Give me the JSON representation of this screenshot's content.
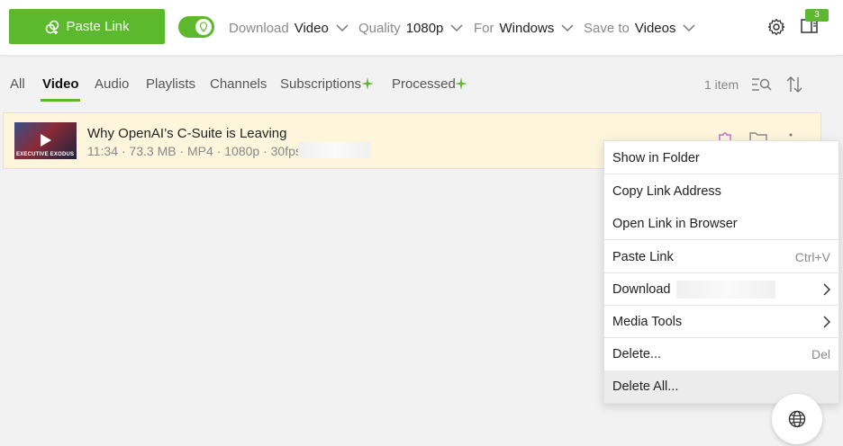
{
  "toolbar": {
    "paste_label": "Paste Link",
    "download": {
      "label": "Download",
      "value": "Video"
    },
    "quality": {
      "label": "Quality",
      "value": "1080p"
    },
    "for": {
      "label": "For",
      "value": "Windows"
    },
    "save_to": {
      "label": "Save to",
      "value": "Videos"
    },
    "badge_count": "3"
  },
  "tabs": [
    {
      "label": "All"
    },
    {
      "label": "Video"
    },
    {
      "label": "Audio"
    },
    {
      "label": "Playlists"
    },
    {
      "label": "Channels"
    },
    {
      "label": "Subscriptions"
    },
    {
      "label": "Processed"
    }
  ],
  "item_count": "1 item",
  "item": {
    "title": "Why OpenAI’s C-Suite is Leaving",
    "meta": "11:34 · 73.3 MB · MP4 · 1080p · 30fps ·",
    "thumbnail_caption": "EXECUTIVE EXODUS"
  },
  "menu": {
    "show_in_folder": "Show in Folder",
    "copy_link": "Copy Link Address",
    "open_link": "Open Link in Browser",
    "paste_link": "Paste Link",
    "paste_shortcut": "Ctrl+V",
    "download": "Download",
    "media_tools": "Media Tools",
    "delete": "Delete...",
    "delete_shortcut": "Del",
    "delete_all": "Delete All..."
  },
  "colors": {
    "accent": "#5cb82d",
    "row_highlight": "#fdf6dc",
    "background": "#f2f2f2"
  },
  "icons": {
    "paste": "link-plus-icon",
    "settings": "gear-icon",
    "sidebar": "panel-icon",
    "search_list": "search-list-icon",
    "sort": "sort-icon",
    "globe": "globe-icon"
  }
}
